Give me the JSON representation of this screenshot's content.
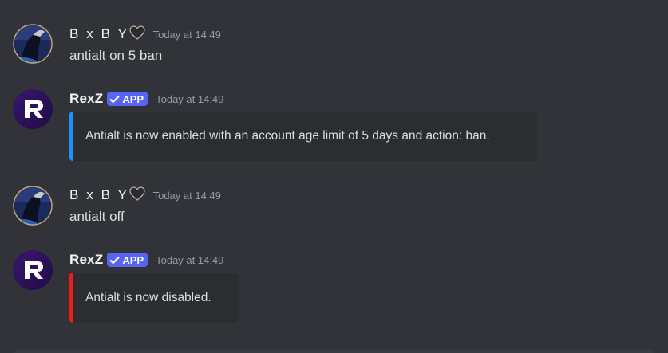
{
  "messages": [
    {
      "author": "B x B Y",
      "author_suffix_icon": "black-heart-icon",
      "timestamp": "Today at 14:49",
      "content": "antialt on 5 ban"
    },
    {
      "author": "RexZ",
      "badge": "APP",
      "badge_icon": "checkmark-icon",
      "timestamp": "Today at 14:49",
      "embed": {
        "text": "Antialt is now enabled with an account age limit of 5 days and action: ban.",
        "accent_color": "#1e90ff"
      }
    },
    {
      "author": "B x B Y",
      "author_suffix_icon": "black-heart-icon",
      "timestamp": "Today at 14:49",
      "content": "antialt off"
    },
    {
      "author": "RexZ",
      "badge": "APP",
      "badge_icon": "checkmark-icon",
      "timestamp": "Today at 14:49",
      "embed": {
        "text": "Antialt is now disabled.",
        "accent_color": "#ed1c1c"
      }
    }
  ],
  "colors": {
    "background": "#313338",
    "embed_background": "#2b2d31",
    "badge": "#5865f2",
    "timestamp": "#949ba4"
  }
}
